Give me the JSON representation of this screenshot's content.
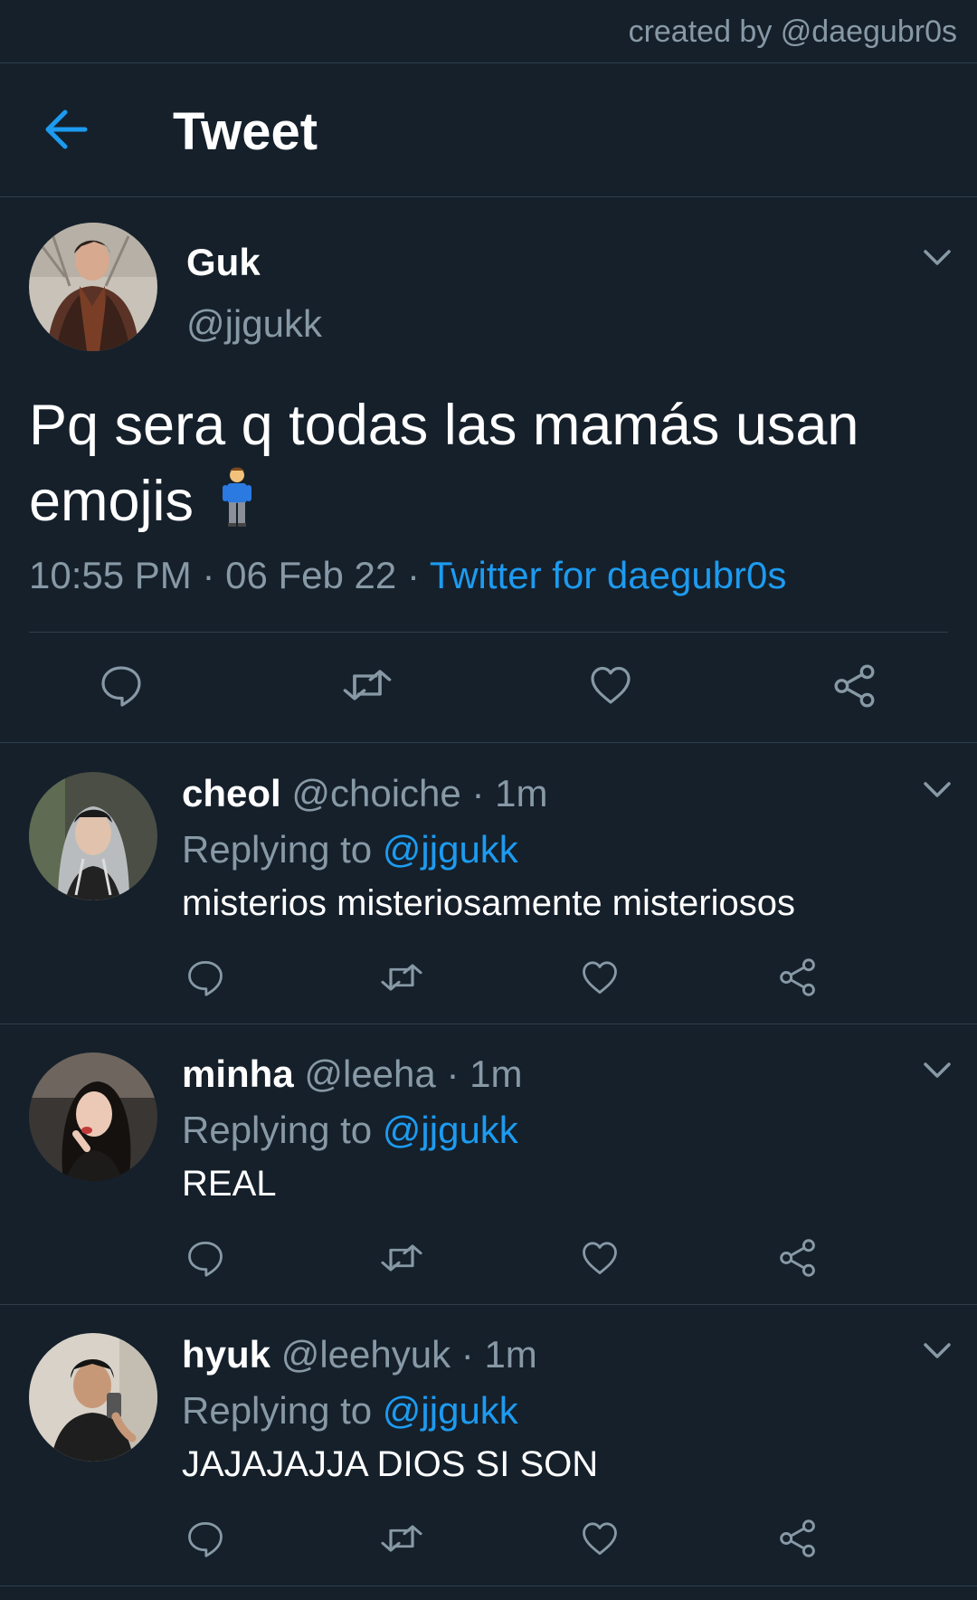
{
  "credit": "created by @daegubr0s",
  "header": {
    "title": "Tweet"
  },
  "tweet": {
    "name": "Guk",
    "handle": "@jjgukk",
    "text": "Pq sera q todas las mamás usan emojis",
    "time": "10:55 PM",
    "sep": "·",
    "date": "06 Feb 22",
    "source": "Twitter for daegubr0s"
  },
  "replies": [
    {
      "name": "cheol",
      "handle": "@choiche",
      "sep": "·",
      "time": "1m",
      "replying_label": "Replying to",
      "replying_to": "@jjgukk",
      "text": "misterios misteriosamente misteriosos"
    },
    {
      "name": "minha",
      "handle": "@leeha",
      "sep": "·",
      "time": "1m",
      "replying_label": "Replying to",
      "replying_to": "@jjgukk",
      "text": "REAL"
    },
    {
      "name": "hyuk",
      "handle": "@leehyuk",
      "sep": "·",
      "time": "1m",
      "replying_label": "Replying to",
      "replying_to": "@jjgukk",
      "text": "JAJAJAJJA DIOS SI SON"
    }
  ],
  "icons": [
    "back-arrow-icon",
    "chevron-down-icon",
    "reply-icon",
    "retweet-icon",
    "like-icon",
    "share-icon",
    "person-standing-emoji"
  ],
  "colors": {
    "background": "#15202b",
    "accent": "#1d9bf0",
    "muted": "#8899a6",
    "divider": "#2f3e4c"
  }
}
